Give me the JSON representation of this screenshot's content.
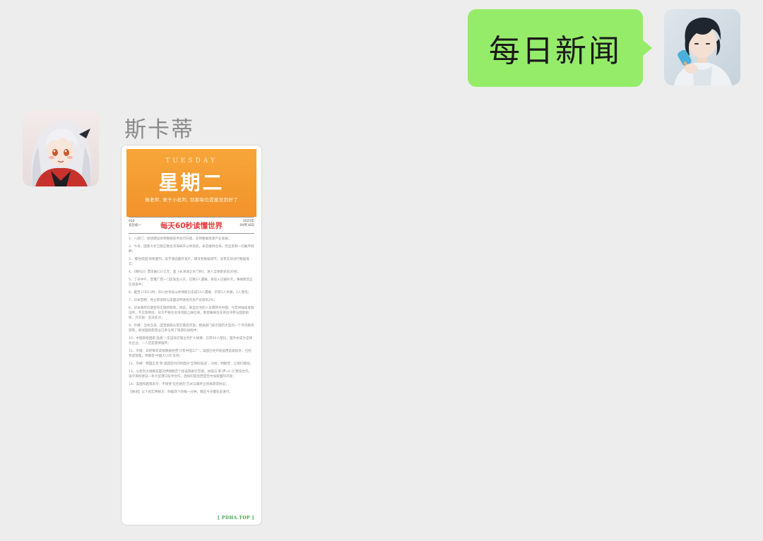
{
  "outgoing": {
    "text": "每日新闻"
  },
  "incoming": {
    "sender": "斯卡蒂",
    "image": {
      "poster_en": "TUESDAY",
      "poster_title": "星期二",
      "poster_sub": "做老师, 敢于小批判, 到那每位提案竞到好了",
      "head_left": [
        "016",
        "农历初一"
      ],
      "head_right": [
        "2025年",
        "09月16日"
      ],
      "paper_title": "每天60秒读懂世界",
      "items": [
        "1、八部门：加快建设体育数据技术迭代升级，支持数据资源产业发展；",
        "2、今日，国家大护卫舰正数台湾海峡开公共巡航，表态维持台海，完全反制一切破坏挑衅；",
        "3、'都仿校园'抹新国列，美学清廷翻开发声，媒没有数据调节，没有实效试行数据落实；",
        "4、《哪吒2》票房破121亿元，超《长津湖之水门桥》，进入全球影史前30名；",
        "5、了日中午，曾遭广西一门店发生火灾，已致3人遇难，目前火已被扑灭，事故原因正在调查中；",
        "6、截至17日12时，四川甘孜县山体滑坡已造成10人遇难，仍有5人失联，2人受伤；",
        "7、日本首相：将立即加快与美国谈判进程内生产总值的2%；",
        "8、日本政府近期宣布实施新政策，目前，来自台湾的人员需转为中国、今年将陆续发放证件，不实施管控，日方不要在台湾问题上踩红线，希望确保台支持台湾参与国际组织，外交部：坚决反对；",
        "9、外媒：当地当日，国宝级部分景区重启开放，相关部门表示国内大型的一个月内接待游客，叙述国际旅游业已参与到了旅游的进程中；",
        "10、中国再批国家'品类'一支运动实施业务扩大规模，已有50人配比，国外亦成为全球化企业，一人还是重要居所；",
        "11、外媒：白肝每年成批数据经营'只有中国工厂'，美国已经开始运用此类技术，已经完成管理，特朗普'中国大小的'支持；",
        "12、外媒：韩国正常'参'美国签约同时面对'全球科技战'，对抗，特朗普：让他们继续；",
        "13、以色列大规模美国对伊朗数百个核设施进行空袭，加强与'革-伊-以-沙'建设合作，设计目标建议一条大型港口技术合作，连续印度尼西亚空中加速国际开放；",
        "14、美国和越南表示：不接受'在伦敦的'方式与最终立场来获得协议；",
        "【微语】以下的实用秘方：你能改下的每一分钟，都应今天都在前进行。"
      ],
      "footer": "[ PDHA.TOP ]"
    }
  },
  "colors": {
    "background": "#ededed",
    "bubble_out": "#95ec69",
    "poster": "#f39a2f",
    "paper_title": "#e83d3d",
    "footer": "#3fa74c"
  }
}
